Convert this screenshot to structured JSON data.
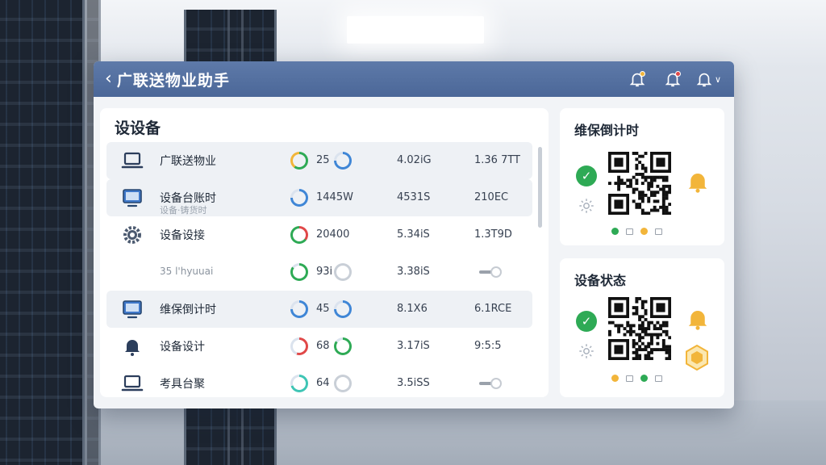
{
  "app": {
    "title": "广联送物业助手"
  },
  "colors": {
    "titlebar": "#4f6b9c",
    "green": "#2eaa55",
    "red": "#e04848",
    "amber": "#f2b53a",
    "blue": "#3f86d6"
  },
  "main": {
    "title": "设设备",
    "rows": [
      {
        "icon": "laptop-icon",
        "name": "广联送物业",
        "sub": "",
        "ring1": "green-amber",
        "metric": "25",
        "ring2": "blue",
        "col3": "4.02iG",
        "col4": "1.36 7TT",
        "shaded": true
      },
      {
        "icon": "monitor-icon",
        "name": "设备台账时",
        "sub": "设备·铸货时",
        "ring1": "blue",
        "metric": "1445W",
        "ring2": "",
        "col3": "4531S",
        "col4": "210EC",
        "shaded": true
      },
      {
        "icon": "gear-icon",
        "name": "设备设接",
        "sub": "",
        "ring1": "red-green",
        "metric": "20400",
        "ring2": "",
        "col3": "5.34iS",
        "col4": "1.3T9D",
        "shaded": false
      },
      {
        "icon": "",
        "name": "",
        "sub": "35 l'hyuuai",
        "ring1": "green",
        "metric": "93i",
        "ring2": "grey",
        "col3": "3.38iS",
        "col4": "",
        "toggle": true,
        "shaded": false
      },
      {
        "icon": "monitor-icon",
        "name": "维保倒计时",
        "sub": "",
        "ring1": "blue",
        "metric": "45",
        "ring2": "blue",
        "col3": "8.1X6",
        "col4": "6.1RCE",
        "shaded": true
      },
      {
        "icon": "bell-icon",
        "name": "设备设计",
        "sub": "",
        "ring1": "red",
        "metric": "68",
        "ring2": "green",
        "col3": "3.17iS",
        "col4": "9:5:5",
        "shaded": false
      },
      {
        "icon": "laptop-icon",
        "name": "考具台聚",
        "sub": "",
        "ring1": "teal",
        "metric": "64",
        "ring2": "grey",
        "col3": "3.5iSS",
        "col4": "",
        "toggle": true,
        "shaded": false
      }
    ]
  },
  "cards": [
    {
      "title": "维保倒计时",
      "bell": "bell-icon",
      "legend": [
        "green",
        "box",
        "amber",
        "box"
      ]
    },
    {
      "title": "设备状态",
      "bell": "bell-icon",
      "badge": "hexagon-badge-icon",
      "legend": [
        "amber",
        "box",
        "green",
        "box"
      ]
    }
  ]
}
